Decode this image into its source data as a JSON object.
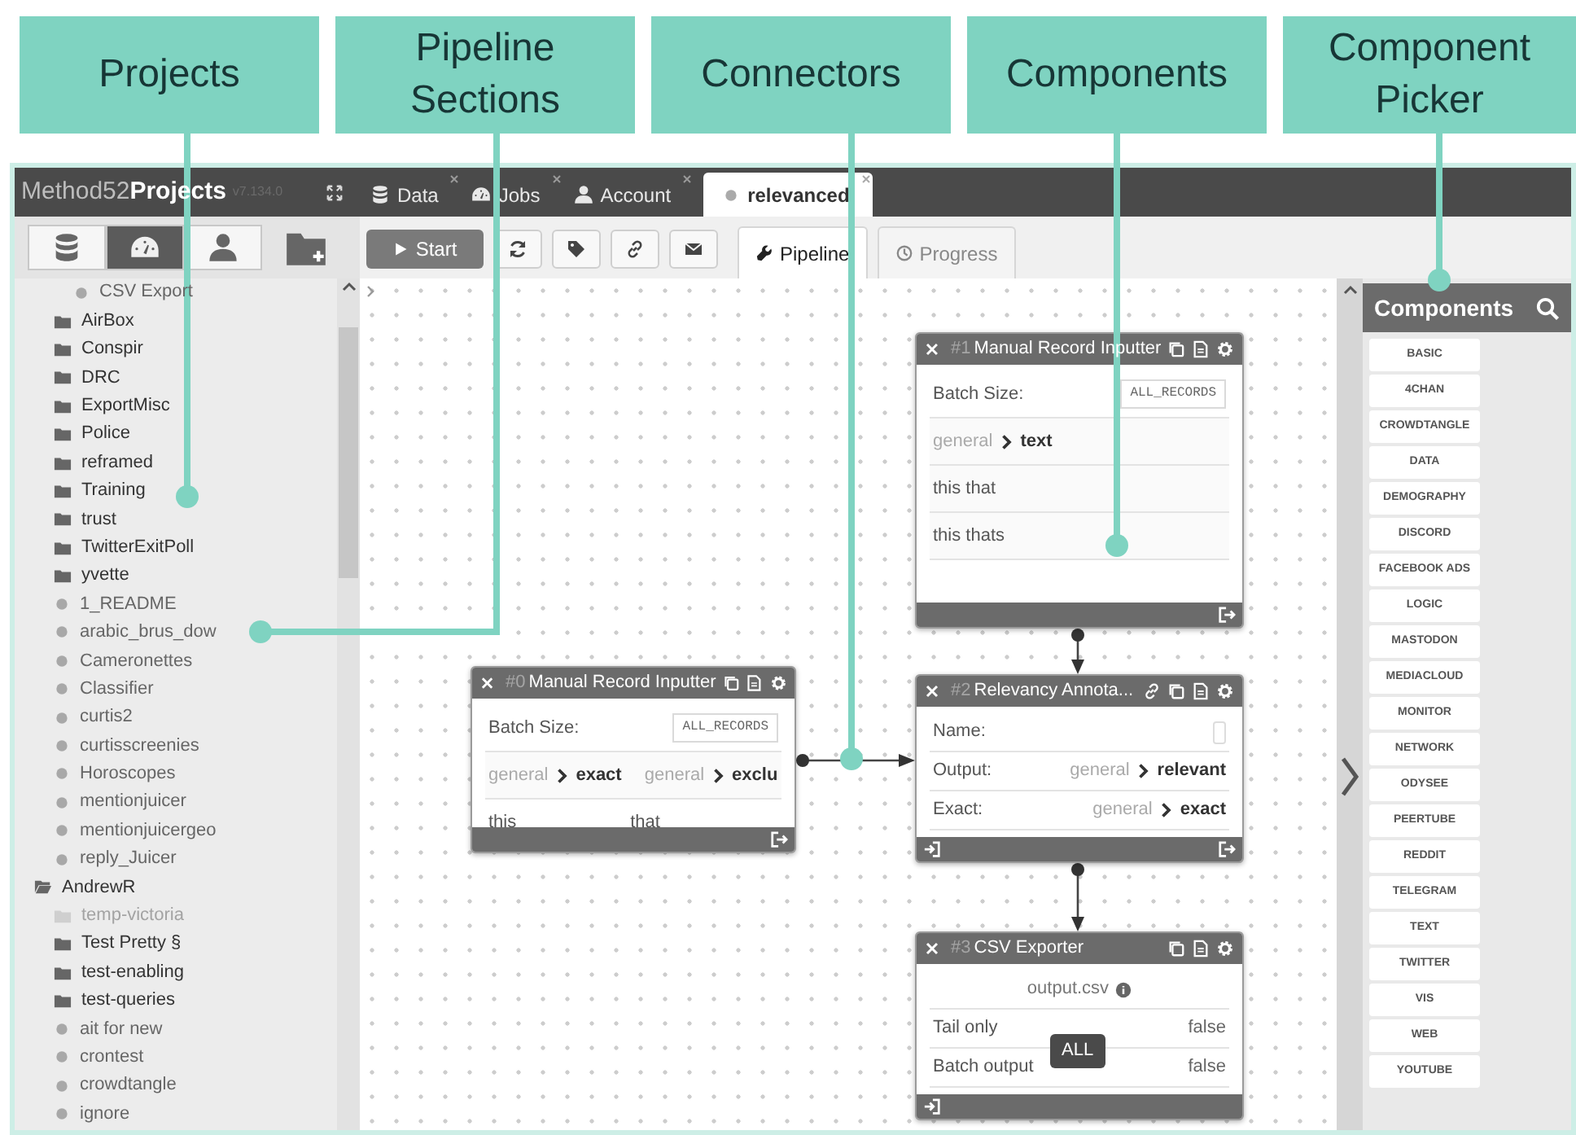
{
  "callouts": [
    {
      "label": "Projects"
    },
    {
      "label": "Pipeline Sections"
    },
    {
      "label": "Connectors"
    },
    {
      "label": "Components"
    },
    {
      "label": "Component Picker"
    }
  ],
  "app": {
    "brand": "Method52",
    "brand_bold": "Projects",
    "version": "v7.134.0"
  },
  "tabs": [
    {
      "label": "Data",
      "selected": false
    },
    {
      "label": "Jobs",
      "selected": false
    },
    {
      "label": "Account",
      "selected": false
    },
    {
      "label": "relevanced",
      "selected": true
    }
  ],
  "sidebar_modes": [
    {
      "selected": false
    },
    {
      "selected": true
    },
    {
      "selected": false
    }
  ],
  "toolbar": {
    "start": "Start"
  },
  "view_tabs": [
    {
      "label": "Pipeline",
      "selected": true
    },
    {
      "label": "Progress",
      "selected": false
    }
  ],
  "project_tree": [
    {
      "children": [
        {
          "children": [
            {
              "label": "CSV Export",
              "kind": "job",
              "disabled": false
            }
          ]
        },
        {
          "label": "AirBox",
          "kind": "folder",
          "disabled": false
        },
        {
          "label": "Conspir",
          "kind": "folder",
          "disabled": false
        },
        {
          "label": "DRC",
          "kind": "folder",
          "disabled": false
        },
        {
          "label": "ExportMisc",
          "kind": "folder",
          "disabled": false
        },
        {
          "label": "Police",
          "kind": "folder",
          "disabled": false
        },
        {
          "label": "reframed",
          "kind": "folder",
          "disabled": false
        },
        {
          "label": "Training",
          "kind": "folder",
          "disabled": false
        },
        {
          "label": "trust",
          "kind": "folder",
          "disabled": false
        },
        {
          "label": "TwitterExitPoll",
          "kind": "folder",
          "disabled": false
        },
        {
          "label": "yvette",
          "kind": "folder",
          "disabled": false
        },
        {
          "label": "1_README",
          "kind": "job",
          "disabled": false
        },
        {
          "label": "arabic_brus_dow",
          "kind": "job",
          "disabled": false
        },
        {
          "label": "Cameronettes",
          "kind": "job",
          "disabled": false
        },
        {
          "label": "Classifier",
          "kind": "job",
          "disabled": false
        },
        {
          "label": "curtis2",
          "kind": "job",
          "disabled": false
        },
        {
          "label": "curtisscreenies",
          "kind": "job",
          "disabled": false
        },
        {
          "label": "Horoscopes",
          "kind": "job",
          "disabled": false
        },
        {
          "label": "mentionjuicer",
          "kind": "job",
          "disabled": false
        },
        {
          "label": "mentionjuicergeo",
          "kind": "job",
          "disabled": false
        },
        {
          "label": "reply_Juicer",
          "kind": "job",
          "disabled": false
        }
      ]
    },
    {
      "label": "AndrewR",
      "kind": "folder-open",
      "disabled": false,
      "children": [
        {
          "label": "temp-victoria",
          "kind": "folder",
          "disabled": true
        },
        {
          "label": "Test Pretty §",
          "kind": "folder",
          "disabled": false
        },
        {
          "label": "test-enabling",
          "kind": "folder",
          "disabled": false
        },
        {
          "label": "test-queries",
          "kind": "folder",
          "disabled": false
        },
        {
          "label": "ait for new",
          "kind": "job",
          "disabled": false
        },
        {
          "label": "crontest",
          "kind": "job",
          "disabled": false
        },
        {
          "label": "crowdtangle",
          "kind": "job",
          "disabled": false
        },
        {
          "label": "ignore",
          "kind": "job",
          "disabled": false
        }
      ]
    }
  ],
  "nodes": [
    {
      "number": "#0",
      "title": "Manual Record Inputter",
      "input": false,
      "output": true,
      "rows": [
        {
          "kind": "field",
          "label": "Batch Size:",
          "value": "ALL_RECORDS"
        },
        {
          "kind": "mappings",
          "items": [
            {
              "source": "general",
              "target": "exact"
            },
            {
              "source": "general",
              "target": "exclu"
            }
          ]
        },
        {
          "kind": "texts",
          "items": [
            "this",
            "that"
          ]
        }
      ]
    },
    {
      "number": "#1",
      "title": "Manual Record Inputter",
      "input": false,
      "output": true,
      "rows": [
        {
          "kind": "field",
          "label": "Batch Size:",
          "value": "ALL_RECORDS"
        },
        {
          "kind": "mappings",
          "items": [
            {
              "source": "general",
              "target": "text"
            }
          ]
        },
        {
          "kind": "text",
          "text": "this that"
        },
        {
          "kind": "text",
          "text": "this thats"
        }
      ]
    },
    {
      "number": "#2",
      "title": "Relevancy Annota...",
      "input": true,
      "output": true,
      "rows": [
        {
          "kind": "input",
          "label": "Name:"
        },
        {
          "kind": "mapping-row",
          "label": "Output:",
          "source": "general",
          "target": "relevant"
        },
        {
          "kind": "mapping-row",
          "label": "Exact:",
          "source": "general",
          "target": "exact"
        }
      ]
    },
    {
      "number": "#3",
      "title": "CSV Exporter",
      "input": true,
      "output": false,
      "tooltip": "ALL",
      "rows": [
        {
          "kind": "file",
          "text": "output.csv"
        },
        {
          "kind": "setting",
          "label": "Tail only",
          "value": "false"
        },
        {
          "kind": "setting",
          "label": "Batch output",
          "value": "false"
        }
      ]
    }
  ],
  "component_picker": {
    "title": "Components",
    "categories": [
      "BASIC",
      "4CHAN",
      "CROWDTANGLE",
      "DATA",
      "DEMOGRAPHY",
      "DISCORD",
      "FACEBOOK ADS",
      "LOGIC",
      "MASTODON",
      "MEDIACLOUD",
      "MONITOR",
      "NETWORK",
      "ODYSEE",
      "PEERTUBE",
      "REDDIT",
      "TELEGRAM",
      "TEXT",
      "TWITTER",
      "VIS",
      "WEB",
      "YOUTUBE"
    ]
  }
}
